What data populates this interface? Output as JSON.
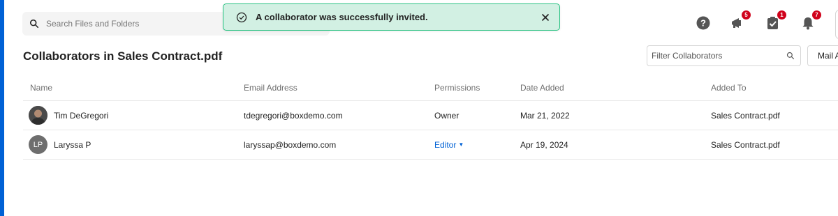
{
  "search": {
    "placeholder": "Search Files and Folders"
  },
  "toast": {
    "message": "A collaborator was successfully invited."
  },
  "header_icons": [
    {
      "name": "help-icon"
    },
    {
      "name": "announcements-icon",
      "badge": "5"
    },
    {
      "name": "tasks-icon",
      "badge": "1"
    },
    {
      "name": "notifications-icon",
      "badge": "7"
    }
  ],
  "page": {
    "title": "Collaborators in Sales Contract.pdf"
  },
  "filter": {
    "placeholder": "Filter Collaborators"
  },
  "mail_button": {
    "label": "Mail A"
  },
  "table": {
    "columns": [
      "Name",
      "Email Address",
      "Permissions",
      "Date Added",
      "Added To"
    ],
    "rows": [
      {
        "avatar": "photo",
        "name": "Tim DeGregori",
        "email": "tdegregori@boxdemo.com",
        "permission": "Owner",
        "date_added": "Mar 21, 2022",
        "added_to": "Sales Contract.pdf"
      },
      {
        "avatar": "LP",
        "name": "Laryssa P",
        "email": "laryssap@boxdemo.com",
        "permission": "Editor",
        "date_added": "Apr 19, 2024",
        "added_to": "Sales Contract.pdf"
      }
    ]
  },
  "colors": {
    "accent": "#0061d5",
    "toast_bg": "#d2f0e3",
    "toast_border": "#26c281",
    "badge": "#d0021b"
  }
}
